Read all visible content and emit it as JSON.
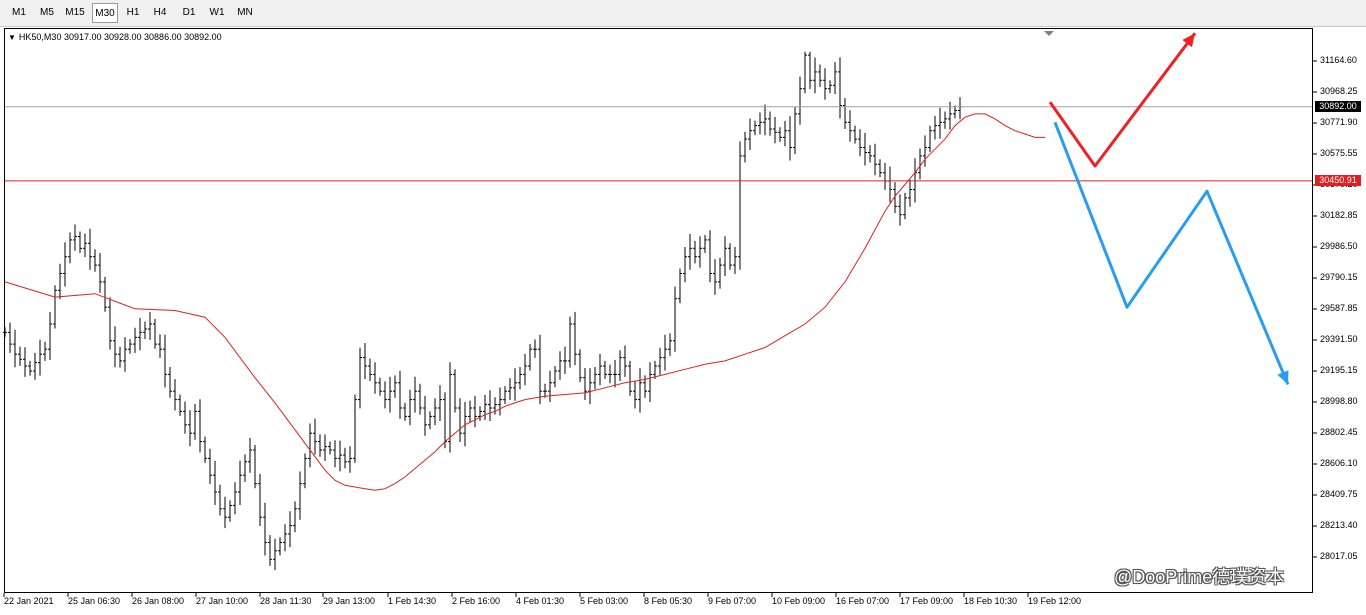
{
  "toolbar": {
    "timeframes": [
      "M1",
      "M5",
      "M15",
      "M30",
      "H1",
      "H4",
      "D1",
      "W1",
      "MN"
    ],
    "active": "M30"
  },
  "symbol_info": {
    "symbol": "HK50,M30",
    "ohlc": "30917.00 30928.00 30886.00 30892.00"
  },
  "price_labels": {
    "current": "30892.00",
    "current_color": "#000000",
    "level": "30450.91",
    "level_color": "#e02020"
  },
  "watermark": "@DooPrime德璞资本",
  "colors": {
    "bars": "#000000",
    "moving_average": "#e02020",
    "horizontal_level": "#e02020",
    "bid_line": "#a0a0a0",
    "arrow_up_scenario": "#ee2222",
    "arrow_down_scenario": "#2a9cf0"
  },
  "chart_data": {
    "type": "line",
    "title": "HK50,M30",
    "xlabel": "",
    "ylabel": "",
    "ylim": [
      28017.05,
      31360.0
    ],
    "grid": false,
    "y_ticks": [
      "31164.60",
      "30968.25",
      "30771.90",
      "30575.55",
      "30379.20",
      "30182.85",
      "29986.50",
      "29790.15",
      "29587.85",
      "29391.50",
      "29195.15",
      "28998.80",
      "28802.45",
      "28606.10",
      "28409.75",
      "28213.40",
      "28017.05"
    ],
    "x_ticks": [
      "22 Jan 2021",
      "25 Jan 06:30",
      "26 Jan 08:00",
      "27 Jan 10:00",
      "28 Jan 11:30",
      "29 Jan 13:00",
      "1 Feb 14:30",
      "2 Feb 16:00",
      "4 Feb 01:30",
      "5 Feb 03:00",
      "8 Feb 05:30",
      "9 Feb 07:00",
      "10 Feb 09:00",
      "16 Feb 07:00",
      "17 Feb 09:00",
      "18 Feb 10:30",
      "19 Feb 12:00"
    ],
    "series": [
      {
        "type": "ohlc",
        "x": [
          0,
          5,
          10,
          15,
          20,
          25,
          30,
          35,
          40,
          45,
          50,
          55,
          60,
          65,
          70,
          75,
          80,
          85,
          90,
          95,
          100,
          105,
          110,
          115,
          120,
          125,
          130,
          135,
          140,
          145,
          150,
          155,
          160,
          165,
          170,
          175,
          180,
          185,
          190,
          195,
          200,
          205,
          210,
          215,
          220,
          225,
          230,
          235,
          240,
          245,
          250,
          255,
          260,
          265,
          270,
          275,
          280,
          285,
          290,
          295,
          300,
          305,
          310,
          315,
          320,
          325,
          330,
          335,
          340,
          345,
          350,
          355,
          360,
          365,
          370,
          375,
          380,
          385,
          390,
          395,
          400,
          405,
          410,
          415,
          420,
          425,
          430,
          435,
          440,
          445,
          450,
          455,
          460,
          465,
          470,
          475,
          480,
          485,
          490,
          495,
          500,
          505,
          510,
          515,
          520,
          525,
          530,
          535,
          540,
          545,
          550,
          555,
          560,
          565,
          570,
          575,
          580,
          585,
          590,
          595,
          600,
          605,
          610,
          615,
          620,
          625,
          630,
          635,
          640,
          645,
          650,
          655,
          660,
          665,
          670,
          675,
          680,
          685,
          690,
          695,
          700,
          705,
          710,
          715,
          720,
          725,
          730,
          735,
          740,
          745,
          750,
          755,
          760,
          765,
          770,
          775,
          780,
          785,
          790,
          795,
          800,
          805,
          810,
          815,
          820,
          825,
          830,
          835,
          840,
          845,
          850,
          855,
          860,
          865,
          870,
          875,
          880,
          885,
          890,
          895,
          900,
          905,
          910,
          915,
          920,
          925,
          930,
          935,
          940,
          945,
          950,
          955,
          960,
          965,
          970,
          975,
          980,
          985,
          990,
          995,
          1000,
          1005,
          1010,
          1015,
          1020,
          1025,
          1030,
          1035,
          1040
        ],
        "close": [
          29550,
          29480,
          29420,
          29390,
          29350,
          29320,
          29370,
          29420,
          29450,
          29600,
          29800,
          29900,
          30000,
          30100,
          30120,
          30050,
          30080,
          30000,
          29950,
          29850,
          29700,
          29500,
          29420,
          29380,
          29450,
          29480,
          29520,
          29550,
          29570,
          29600,
          29480,
          29450,
          29300,
          29200,
          29150,
          29080,
          29000,
          28950,
          29080,
          28900,
          28800,
          28700,
          28600,
          28500,
          28450,
          28520,
          28600,
          28700,
          28780,
          28850,
          28650,
          28450,
          28300,
          28200,
          28250,
          28300,
          28350,
          28400,
          28500,
          28650,
          28800,
          28950,
          28900,
          28850,
          28870,
          28850,
          28800,
          28820,
          28780,
          28800,
          29150,
          29400,
          29350,
          29300,
          29250,
          29200,
          29150,
          29200,
          29250,
          29100,
          29050,
          29150,
          29200,
          29100,
          29000,
          29050,
          29100,
          29150,
          28900,
          29300,
          29100,
          28950,
          29050,
          29100,
          29050,
          29080,
          29120,
          29100,
          29120,
          29150,
          29200,
          29220,
          29250,
          29300,
          29350,
          29450,
          29450,
          29200,
          29200,
          29250,
          29320,
          29380,
          29380,
          29600,
          29420,
          29280,
          29200,
          29250,
          29300,
          29350,
          29300,
          29300,
          29300,
          29400,
          29350,
          29200,
          29150,
          29250,
          29200,
          29300,
          29350,
          29400,
          29450,
          29500,
          29750,
          29900,
          30000,
          30050,
          30000,
          30050,
          30100,
          29900,
          29850,
          29950,
          30050,
          29950,
          30000,
          30600,
          30700,
          30750,
          30780,
          30800,
          30820,
          30760,
          30740,
          30710,
          30750,
          30650,
          30850,
          31000,
          31200,
          31050,
          31100,
          31050,
          31000,
          31020,
          31100,
          30900,
          30800,
          30750,
          30700,
          30650,
          30620,
          30600,
          30550,
          30500,
          30450,
          30400,
          30300,
          30250,
          30350,
          30400,
          30500,
          30600,
          30650,
          30750,
          30780,
          30800,
          30820,
          30850,
          30870,
          30892
        ],
        "high_max": 31220,
        "low_min": 28090
      },
      {
        "type": "line",
        "name": "",
        "x": [
          0,
          50,
          90,
          130,
          170,
          200,
          220,
          250,
          270,
          290,
          310,
          320,
          330,
          340,
          350,
          360,
          370,
          380,
          390,
          400,
          410,
          420,
          430,
          440,
          450,
          460,
          470,
          480,
          490,
          500,
          510,
          520,
          530,
          540,
          560,
          580,
          600,
          620,
          640,
          660,
          680,
          700,
          720,
          740,
          760,
          780,
          800,
          820,
          840,
          860,
          870,
          880,
          890,
          900,
          910,
          920,
          930,
          940,
          950,
          960,
          970,
          980,
          990,
          1000,
          1010,
          1020,
          1030,
          1040
        ],
        "y": [
          29850,
          29760,
          29780,
          29690,
          29680,
          29640,
          29520,
          29280,
          29130,
          28970,
          28810,
          28730,
          28670,
          28640,
          28630,
          28620,
          28610,
          28620,
          28650,
          28690,
          28740,
          28790,
          28840,
          28900,
          28950,
          29000,
          29030,
          29060,
          29080,
          29110,
          29130,
          29150,
          29160,
          29170,
          29180,
          29190,
          29220,
          29250,
          29270,
          29300,
          29330,
          29360,
          29380,
          29420,
          29460,
          29530,
          29600,
          29700,
          29850,
          30050,
          30160,
          30270,
          30360,
          30430,
          30500,
          30580,
          30640,
          30700,
          30780,
          30830,
          30850,
          30850,
          30820,
          30780,
          30750,
          30730,
          30710,
          30710
        ]
      },
      {
        "type": "hline",
        "name": "",
        "y": [
          30450.91
        ]
      },
      {
        "type": "projection",
        "name": "",
        "x": [
          1050,
          1095,
          1195
        ],
        "y": [
          30920,
          30540,
          31330
        ]
      },
      {
        "type": "projection",
        "name": "",
        "x": [
          1055,
          1127,
          1207,
          1288
        ],
        "y": [
          30800,
          29700,
          30390,
          29240
        ]
      }
    ]
  }
}
